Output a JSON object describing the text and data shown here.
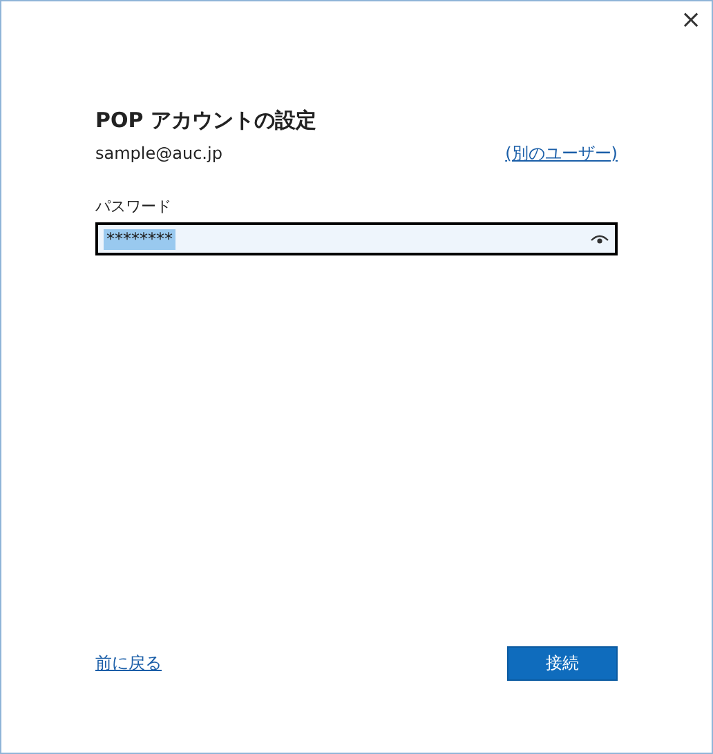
{
  "window": {
    "close": "×"
  },
  "title": "POP アカウントの設定",
  "account": {
    "email": "sample@auc.jp",
    "switch_link": "(別のユーザー)"
  },
  "password": {
    "label": "パスワード",
    "value": "********",
    "selected": true
  },
  "footer": {
    "back_link": "前に戻る",
    "connect_button": "接続"
  }
}
